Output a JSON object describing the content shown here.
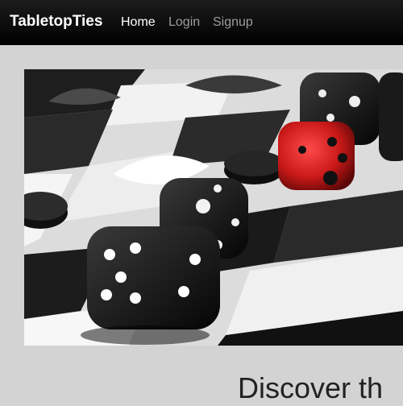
{
  "navbar": {
    "brand": "TabletopTies",
    "links": [
      {
        "label": "Home",
        "active": true
      },
      {
        "label": "Login",
        "active": false
      },
      {
        "label": "Signup",
        "active": false
      }
    ]
  },
  "hero": {
    "image": "dice-on-board-photo"
  },
  "main": {
    "heading": "Discover th"
  },
  "colors": {
    "navbar_bg": "#000000",
    "page_bg": "#d3d3d3",
    "accent_die": "#d62020"
  }
}
